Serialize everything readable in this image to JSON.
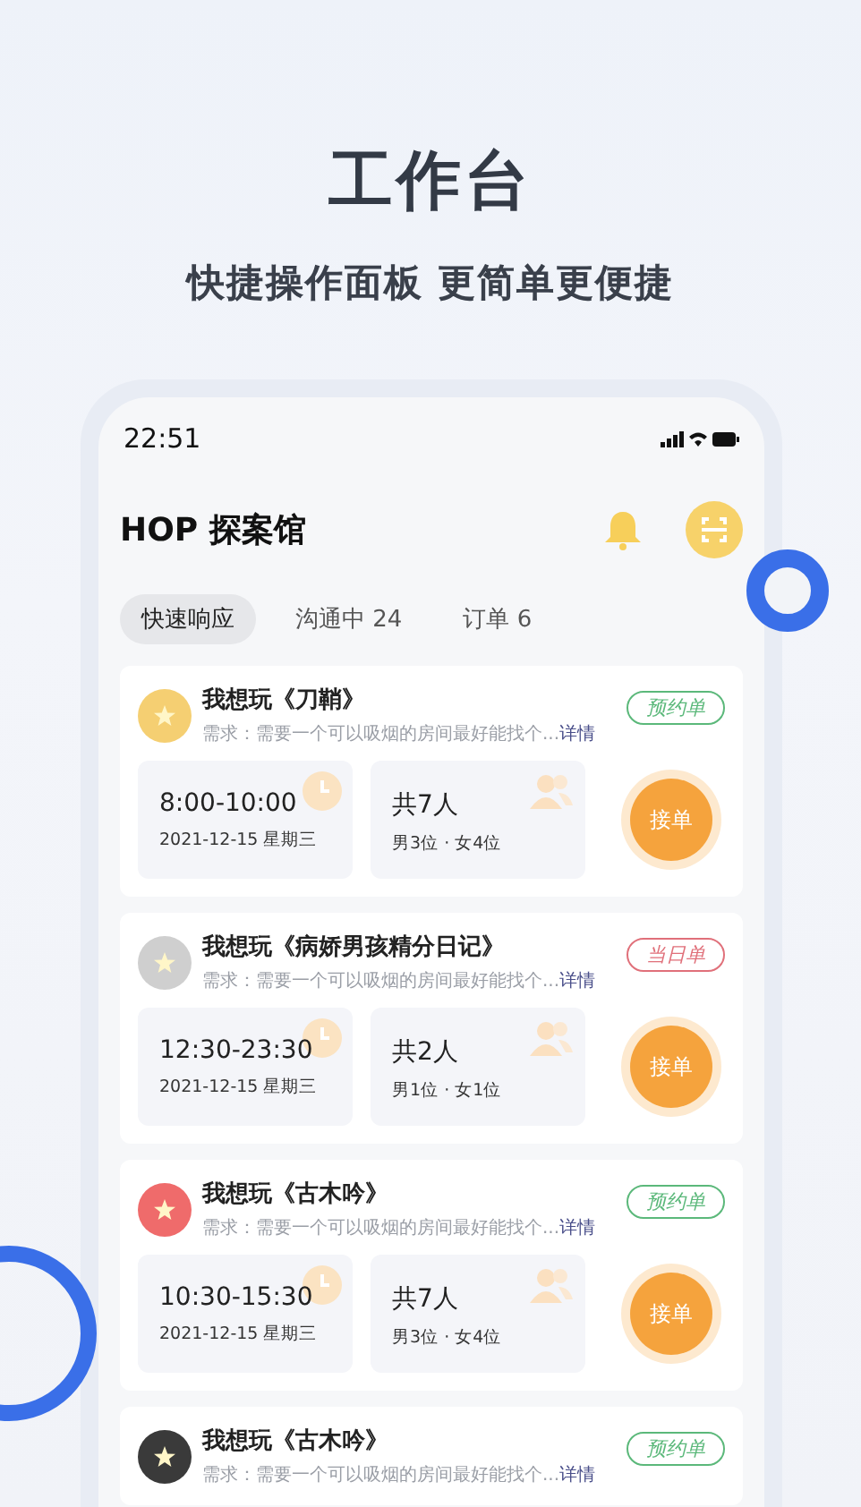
{
  "promo": {
    "title": "工作台",
    "subtitle": "快捷操作面板 更简单更便捷"
  },
  "status_bar": {
    "time": "22:51"
  },
  "app_bar": {
    "title": "HOP 探案馆"
  },
  "tabs": [
    {
      "label": "快速响应",
      "selected": true
    },
    {
      "label": "沟通中 24",
      "selected": false
    },
    {
      "label": "订单 6",
      "selected": false
    }
  ],
  "orders": [
    {
      "title": "我想玩《刀鞘》",
      "need": "需求：需要一个可以吸烟的房间最好能找个...",
      "link": "详情",
      "tag": {
        "label": "预约单",
        "color": "#5bb87a"
      },
      "avatar": {
        "color": "#f5cf72"
      },
      "time": "8:00-10:00",
      "date": "2021-12-15 星期三",
      "people": "共7人",
      "gender": "男3位  ·  女4位",
      "action": "接单"
    },
    {
      "title": "我想玩《病娇男孩精分日记》",
      "need": "需求：需要一个可以吸烟的房间最好能找个...",
      "link": "详情",
      "tag": {
        "label": "当日单",
        "color": "#e0707a"
      },
      "avatar": {
        "color": "#cfcfcf"
      },
      "time": "12:30-23:30",
      "date": "2021-12-15 星期三",
      "people": "共2人",
      "gender": "男1位  ·  女1位",
      "action": "接单"
    },
    {
      "title": "我想玩《古木吟》",
      "need": "需求：需要一个可以吸烟的房间最好能找个...",
      "link": "详情",
      "tag": {
        "label": "预约单",
        "color": "#5bb87a"
      },
      "avatar": {
        "color": "#ef6b6b"
      },
      "time": "10:30-15:30",
      "date": "2021-12-15 星期三",
      "people": "共7人",
      "gender": "男3位  ·  女4位",
      "action": "接单"
    },
    {
      "title": "我想玩《古木吟》",
      "need": "需求：需要一个可以吸烟的房间最好能找个...",
      "link": "详情",
      "tag": {
        "label": "预约单",
        "color": "#5bb87a"
      },
      "avatar": {
        "color": "#3a3a3a"
      }
    }
  ]
}
